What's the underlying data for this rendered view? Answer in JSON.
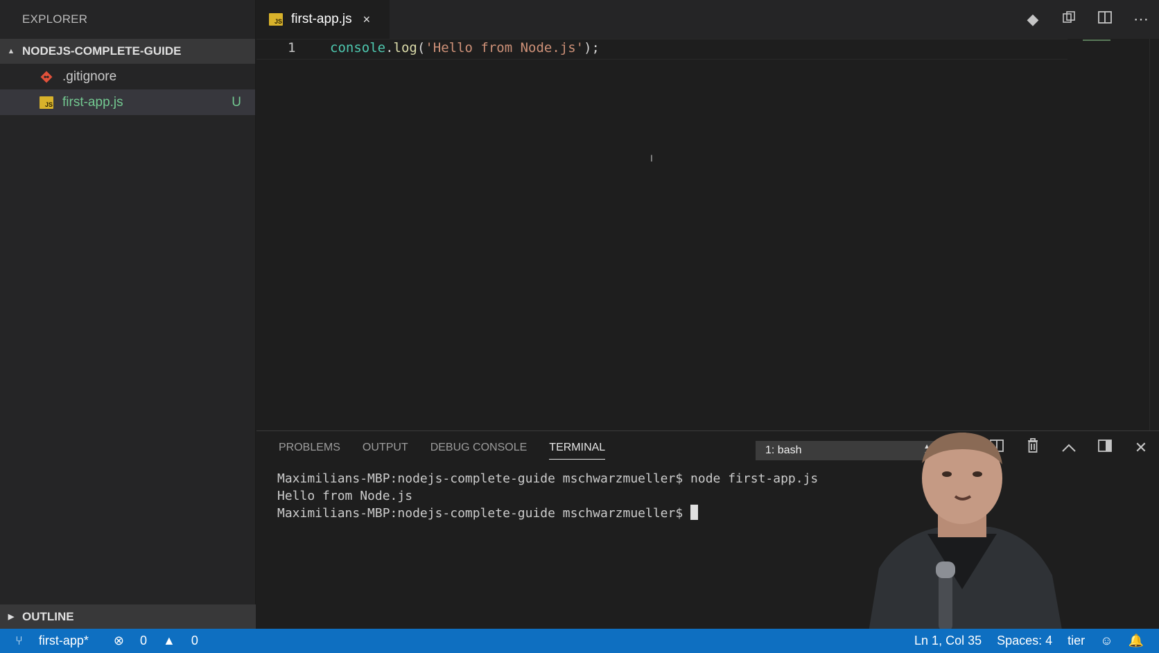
{
  "sidebar": {
    "title": "EXPLORER",
    "project": "NODEJS-COMPLETE-GUIDE",
    "files": [
      {
        "name": ".gitignore",
        "icon": "git-icon",
        "badge": ""
      },
      {
        "name": "first-app.js",
        "icon": "js-file-icon",
        "badge": "U",
        "selected": true
      }
    ],
    "outline": "OUTLINE"
  },
  "editor": {
    "tab_label": "first-app.js",
    "tab_close": "×",
    "line_number": "1",
    "code_tokens": [
      "console",
      ".",
      "log",
      "(",
      "'Hello from Node.js'",
      ");"
    ]
  },
  "panel": {
    "tabs": [
      "PROBLEMS",
      "OUTPUT",
      "DEBUG CONSOLE",
      "TERMINAL"
    ],
    "active_tab": "TERMINAL",
    "terminal_select": "1: bash",
    "terminal_lines": [
      "Maximilians-MBP:nodejs-complete-guide mschwarzmueller$ node first-app.js",
      "Hello from Node.js",
      "Maximilians-MBP:nodejs-complete-guide mschwarzmueller$ "
    ]
  },
  "status": {
    "branch": "first-app*",
    "errors": "0",
    "warnings": "0",
    "position": "Ln 1, Col 35",
    "spaces": "Spaces: 4",
    "formatter": "tier"
  },
  "colors": {
    "status_bar": "#0e6fc1",
    "sidebar_bg": "#252526",
    "editor_bg": "#1e1e1e",
    "untracked_green": "#73c991",
    "js_icon": "#d8b22b",
    "git_icon": "#e2513a"
  }
}
